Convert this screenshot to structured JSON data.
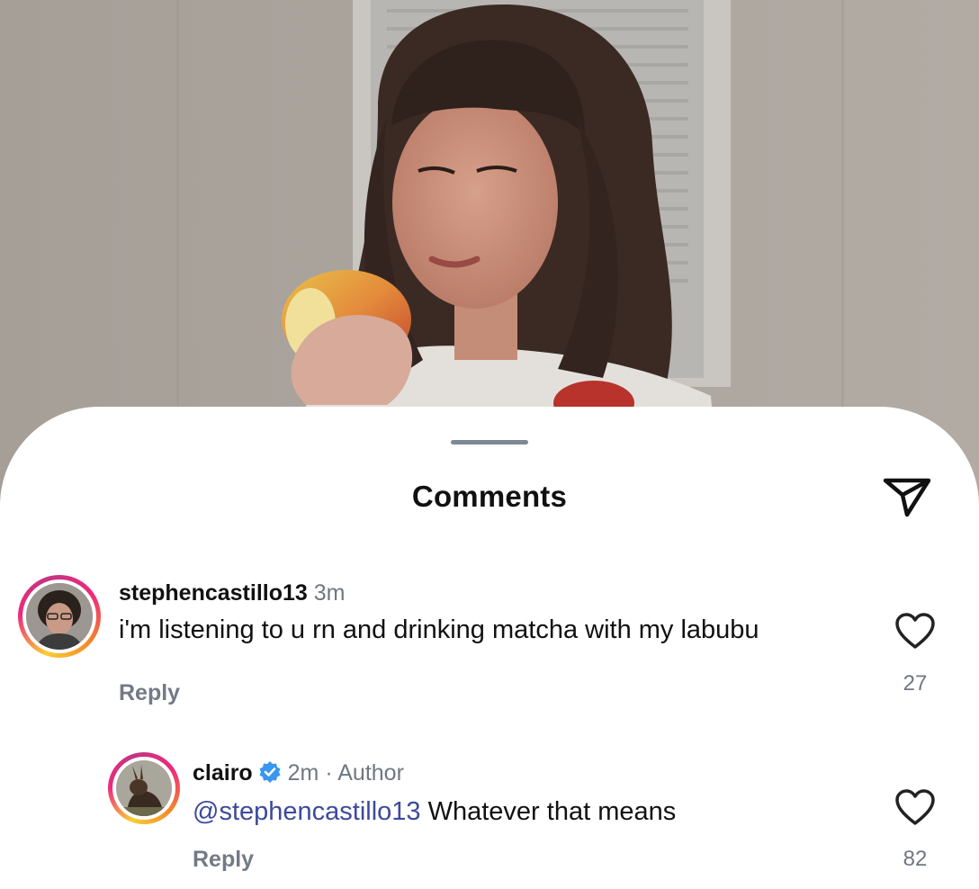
{
  "sheet": {
    "title": "Comments"
  },
  "comments": [
    {
      "username": "stephencastillo13",
      "time": "3m",
      "text": "i'm listening to u rn and drinking matcha with my labubu",
      "reply_label": "Reply",
      "likes": "27"
    },
    {
      "username": "clairo",
      "time": "2m",
      "separator": "·",
      "author_tag": "Author",
      "mention": "@stephencastillo13",
      "text": "Whatever that means",
      "reply_label": "Reply",
      "likes": "82"
    }
  ],
  "icons": {
    "share": "send-icon",
    "like": "heart-icon",
    "verified": "verified-badge-icon"
  },
  "colors": {
    "mention": "#3c4a9c",
    "verified": "#3897f0",
    "meta": "#707783"
  }
}
